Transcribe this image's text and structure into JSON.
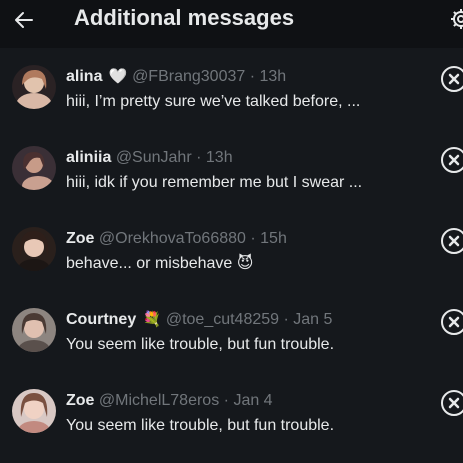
{
  "header": {
    "back_icon": "arrow-left-icon",
    "title": "Additional messages",
    "settings_icon": "gear-icon"
  },
  "messages": [
    {
      "name": "alina",
      "badge": "🤍",
      "handle": "@FBrang30037",
      "sep": "·",
      "time": "13h",
      "text": "hiii, I’m pretty sure we’ve talked before, ...",
      "avatar_color": "#8a6a5a"
    },
    {
      "name": "aliniia",
      "badge": "",
      "handle": "@SunJahr",
      "sep": "·",
      "time": "13h",
      "text": "hiii, idk if you remember me but I swear ...",
      "avatar_color": "#5a4a50"
    },
    {
      "name": "Zoe",
      "badge": "",
      "handle": "@OrekhovaTo66880",
      "sep": "·",
      "time": "15h",
      "text": "behave... or misbehave 😈",
      "avatar_color": "#3a2a26"
    },
    {
      "name": "Courtney",
      "badge": "💐",
      "handle": "@toe_cut48259",
      "sep": "·",
      "time": "Jan 5",
      "text": "You seem like trouble, but fun trouble.",
      "avatar_color": "#7a6a66"
    },
    {
      "name": "Zoe",
      "badge": "",
      "handle": "@MichelL78eros",
      "sep": "·",
      "time": "Jan 4",
      "text": "You seem like trouble, but fun trouble.",
      "avatar_color": "#b08a80"
    }
  ],
  "dismiss_icon": "close-circle-icon"
}
